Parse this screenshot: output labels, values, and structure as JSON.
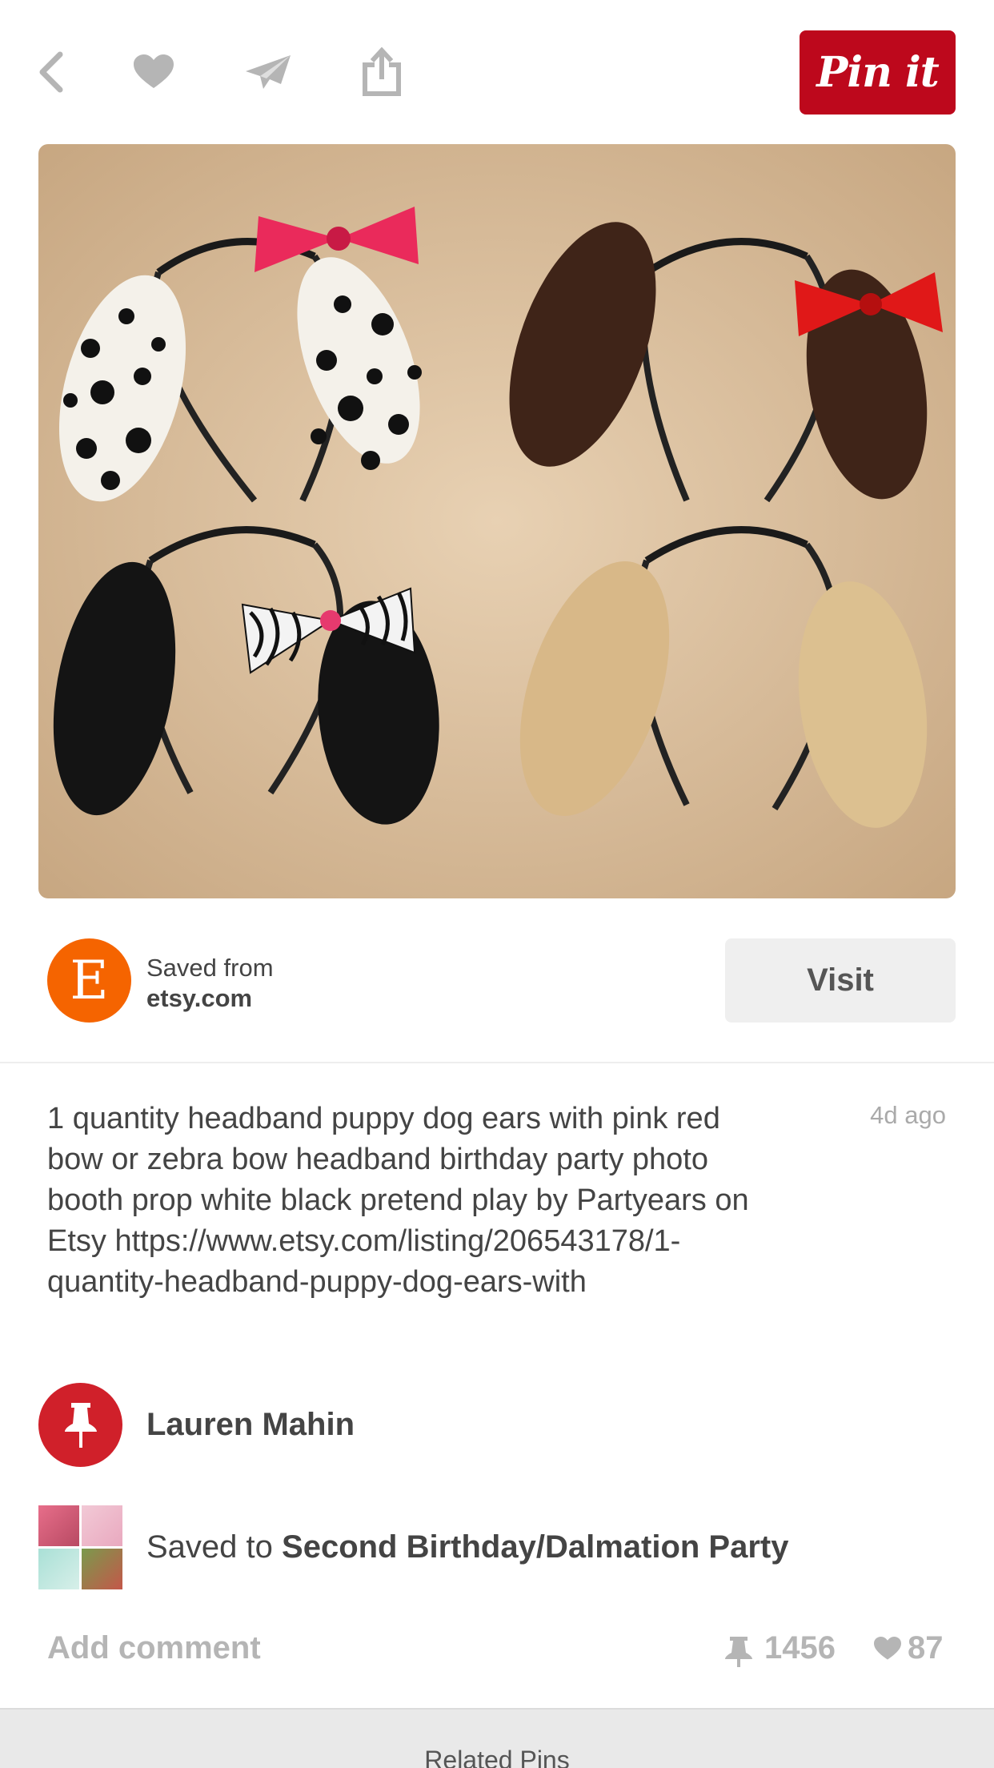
{
  "toolbar": {
    "icons": [
      "back-arrow-icon",
      "heart-icon",
      "send-icon",
      "share-icon"
    ],
    "pin_it_label": "Pin it",
    "brand_color": "#bd081c"
  },
  "pin": {
    "image_alt": "Four felt puppy dog ear headbands: dalmatian with pink bow, brown with red bow, black with zebra bow, tan"
  },
  "source": {
    "saved_from_label": "Saved from",
    "domain": "etsy.com",
    "logo_letter": "E",
    "logo_color": "#f56400",
    "visit_label": "Visit"
  },
  "description": {
    "text": "1 quantity headband puppy dog ears with pink red bow or zebra bow headband birthday party photo booth prop white black pretend play by Partyears on Etsy https://www.etsy.com/listing/206543178/1-quantity-headband-puppy-dog-ears-with",
    "timestamp": "4d ago"
  },
  "pinner": {
    "name": "Lauren Mahin",
    "avatar_icon": "pushpin-icon",
    "avatar_color": "#d0202a"
  },
  "board": {
    "saved_to_label": "Saved to",
    "name": "Second Birthday/Dalmation Party"
  },
  "actions": {
    "add_comment_label": "Add comment",
    "repin_count": "1456",
    "like_count": "87"
  },
  "related": {
    "label": "Related Pins"
  }
}
